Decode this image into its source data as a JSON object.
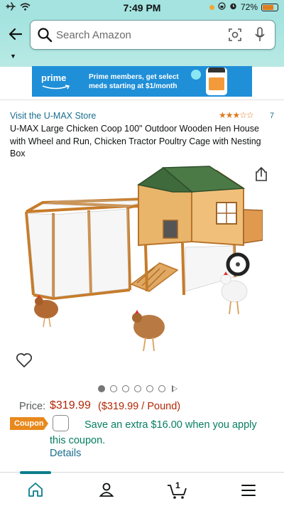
{
  "status_bar": {
    "time": "7:49 PM",
    "battery_percent": "72%"
  },
  "header": {
    "search_placeholder": "Search Amazon"
  },
  "prime_banner": {
    "logo_text": "prime",
    "message": "Prime members, get select meds starting at $1/month"
  },
  "product": {
    "store_link": "Visit the U-MAX Store",
    "rating_stars": 3.5,
    "rating_count": "7",
    "title": "U-MAX Large Chicken Coop 100\" Outdoor Wooden Hen House with Wheel and Run, Chicken Tractor Poultry Cage with Nesting Box",
    "image_count": 6,
    "active_image_index": 0,
    "has_video": true
  },
  "price": {
    "label": "Price:",
    "value": "$319.99",
    "unit_price": "($319.99 / Pound)"
  },
  "coupon": {
    "badge": "Coupon",
    "text": "Save an extra $16.00 when you apply this coupon.",
    "details_link": "Details"
  },
  "bottom_nav": {
    "items": [
      "home-icon",
      "account-icon",
      "cart-icon",
      "menu-icon"
    ],
    "cart_count": "1",
    "accent_color": "#0b7e8c"
  },
  "colors": {
    "header_bg": "#a4e3e0",
    "price": "#b12704",
    "link": "#1a6e8e",
    "coupon_text": "#067d62",
    "coupon_badge": "#e8891d"
  }
}
